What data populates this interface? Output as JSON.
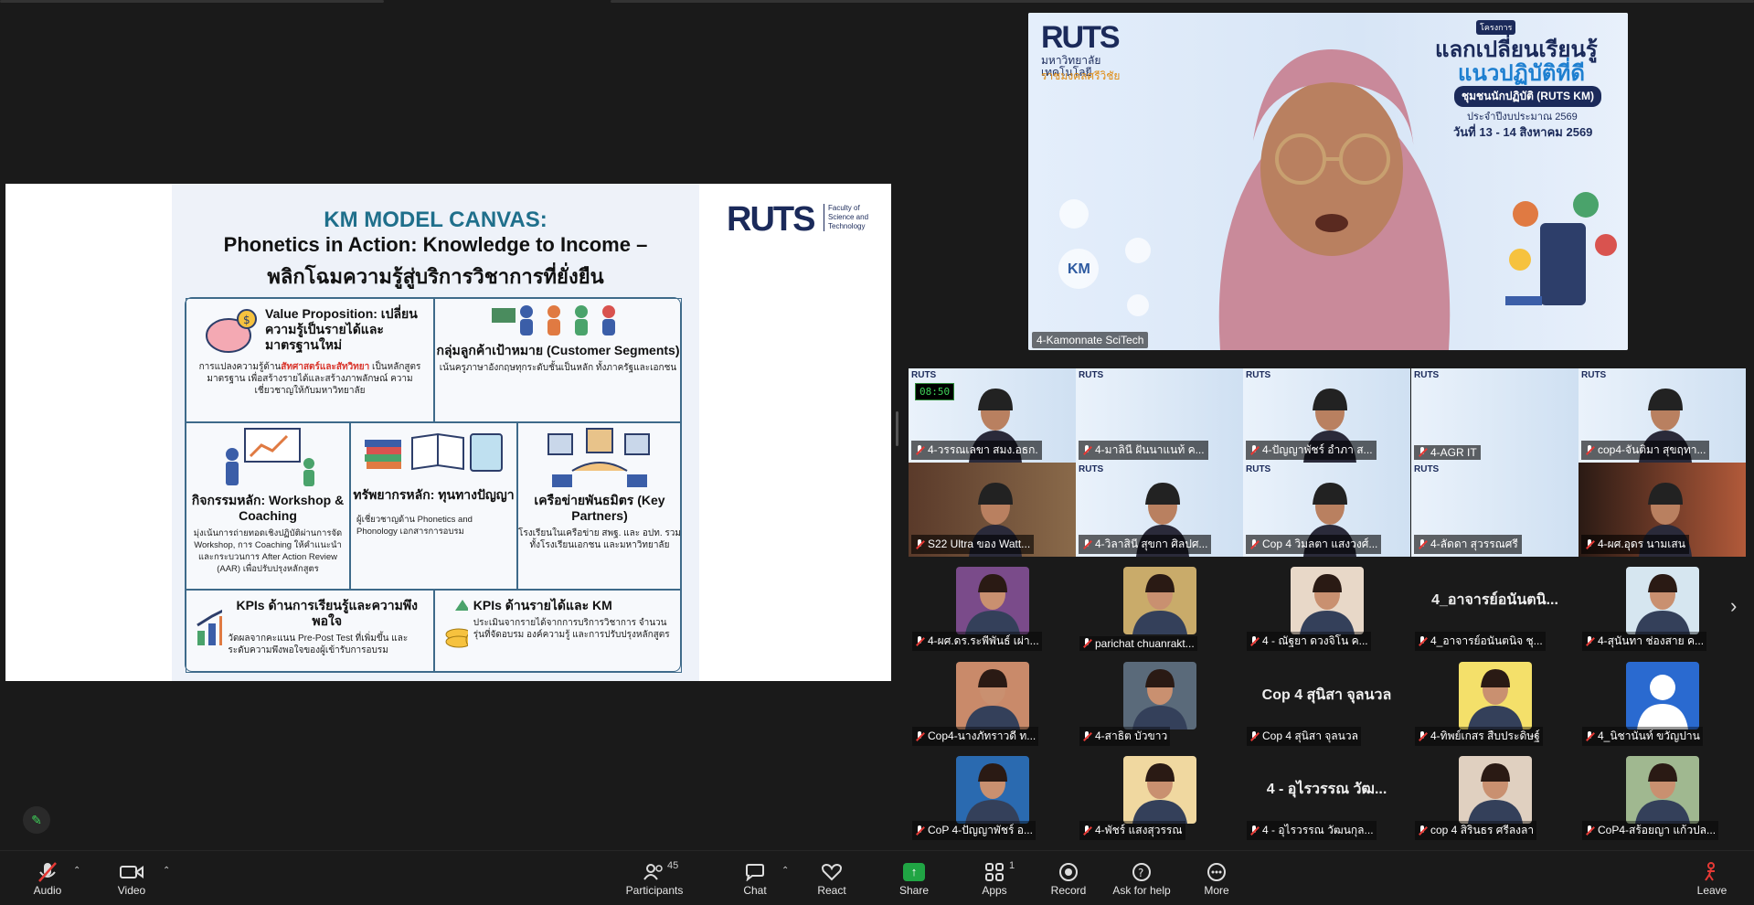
{
  "slide": {
    "title1": "KM MODEL CANVAS:",
    "title2": "Phonetics in Action: Knowledge to Income –",
    "title3": "พลิกโฉมความรู้สู่บริการวิชาการที่ยั่งยืน",
    "brand_logo": "RUTS",
    "brand_faculty": "Faculty of Science and Technology",
    "cells": {
      "value_title": "Value Proposition: เปลี่ยนความรู้เป็นรายได้และมาตรฐานใหม่",
      "value_body_pre": "การแปลงความรู้ด้าน",
      "value_body_hl": "สัทศาสตร์และสัทวิทยา",
      "value_body_post": " เป็นหลักสูตรมาตรฐาน เพื่อสร้างรายได้และสร้างภาพลักษณ์ ความเชี่ยวชาญให้กับมหาวิทยาลัย",
      "segments_title": "กลุ่มลูกค้าเป้าหมาย (Customer Segments)",
      "segments_body": "เน้นครูภาษาอังกฤษทุกระดับชั้นเป็นหลัก ทั้งภาครัฐและเอกชน",
      "activity_title": "กิจกรรมหลัก: Workshop & Coaching",
      "activity_body": "มุ่งเน้นการถ่ายทอดเชิงปฏิบัติผ่านการจัด Workshop, การ Coaching ให้คำแนะนำ และกระบวนการ After Action Review (AAR) เพื่อปรับปรุงหลักสูตร",
      "resource_title": "ทรัพยากรหลัก: ทุนทางปัญญา",
      "resource_body": "ผู้เชี่ยวชาญด้าน Phonetics and Phonology เอกสารการอบรม",
      "partner_title": "เครือข่ายพันธมิตร (Key Partners)",
      "partner_body": "โรงเรียนในเครือข่าย สพฐ. และ อปท. รวมทั้งโรงเรียนเอกชน และมหาวิทยาลัย",
      "kpi1_title": "KPIs ด้านการเรียนรู้และความพึงพอใจ",
      "kpi1_body": "วัดผลจากคะแนน Pre-Post Test ที่เพิ่มขึ้น และระดับความพึงพอใจของผู้เข้ารับการอบรม",
      "kpi2_title": "KPIs ด้านรายได้และ KM",
      "kpi2_body": "ประเมินจากรายได้จากการบริการวิชาการ จำนวนรุ่นที่จัดอบรม องค์ความรู้ และการปรับปรุงหลักสูตร"
    }
  },
  "speaker": {
    "logo": "RUTS",
    "uni_th": "มหาวิทยาลัยเทคโนโลยี",
    "uni_th2": "ราชมงคลศรีวิชัย",
    "tag": "โครงการ",
    "line1": "แลกเปลี่ยนเรียนรู้",
    "line2": "แนวปฏิบัติที่ดี",
    "line3": "ชุมชนนักปฏิบัติ (RUTS KM)",
    "line4": "ประจำปีงบประมาณ 2569",
    "line5": "วันที่ 13 - 14 สิงหาคม 2569",
    "km_label": "KM",
    "name": "4-Kamonnate SciTech"
  },
  "timer": "08:50",
  "video_tiles": [
    {
      "name": "4-วรรณเลขา สมง.อธก."
    },
    {
      "name": "4-มาลินี ฝันนาแนท้ ค..."
    },
    {
      "name": "4-ปัญญาพัชร์ อำภา ส..."
    },
    {
      "name": "4-AGR IT"
    },
    {
      "name": "cop4-จันติมา สุขฤทา..."
    },
    {
      "name": "S22 Ultra ของ Watt..."
    },
    {
      "name": "4-วิลาสินี สุขกา ศิลปศ..."
    },
    {
      "name": "Cop 4 วิมลตา แสงวงศ์..."
    },
    {
      "name": "4-ลัดดา สุวรรณศรี"
    },
    {
      "name": "4-ผศ.อุดร นามเสน"
    }
  ],
  "avatar_tiles": [
    {
      "name": "4-ผศ.ดร.ระพีพันธ์ เผ่า...",
      "text": ""
    },
    {
      "name": "parichat chuanrakt...",
      "text": ""
    },
    {
      "name": "4 - ณัฐยา ดวงจิโน ค...",
      "text": ""
    },
    {
      "name": "4_อาจารย์อนันตนิจ ชุ...",
      "text": "4_อาจารย์อนันตนิ..."
    },
    {
      "name": "4-สุนันทา ช่องสาย ค...",
      "text": ""
    },
    {
      "name": "Cop4-นางภัทราวดี ท...",
      "text": ""
    },
    {
      "name": "4-สาธิต บัวขาว",
      "text": ""
    },
    {
      "name": "Cop 4 สุนิสา จุลนวล",
      "text": "Cop 4 สุนิสา จุลนวล"
    },
    {
      "name": "4-ทิพย์เกสร สืบประดิษฐ์",
      "text": ""
    },
    {
      "name": "4_นิชานันท์ ขวัญปาน",
      "text": ""
    },
    {
      "name": "CoP 4-ปัญญาพัชร์ อ...",
      "text": ""
    },
    {
      "name": "4-พัชร์ แสงสุวรรณ",
      "text": ""
    },
    {
      "name": "4 - อุไรวรรณ วัฒนกุล...",
      "text": "4 - อุไรวรรณ วัฒ..."
    },
    {
      "name": "cop 4 สิรินธร ศรีลงลา",
      "text": ""
    },
    {
      "name": "CoP4-สร้อยญา แก้วปล...",
      "text": ""
    }
  ],
  "toolbar": {
    "audio": "Audio",
    "video": "Video",
    "participants": "Participants",
    "participants_count": "45",
    "chat": "Chat",
    "react": "React",
    "share": "Share",
    "apps": "Apps",
    "apps_count": "1",
    "record": "Record",
    "help": "Ask for help",
    "more": "More",
    "leave": "Leave"
  }
}
